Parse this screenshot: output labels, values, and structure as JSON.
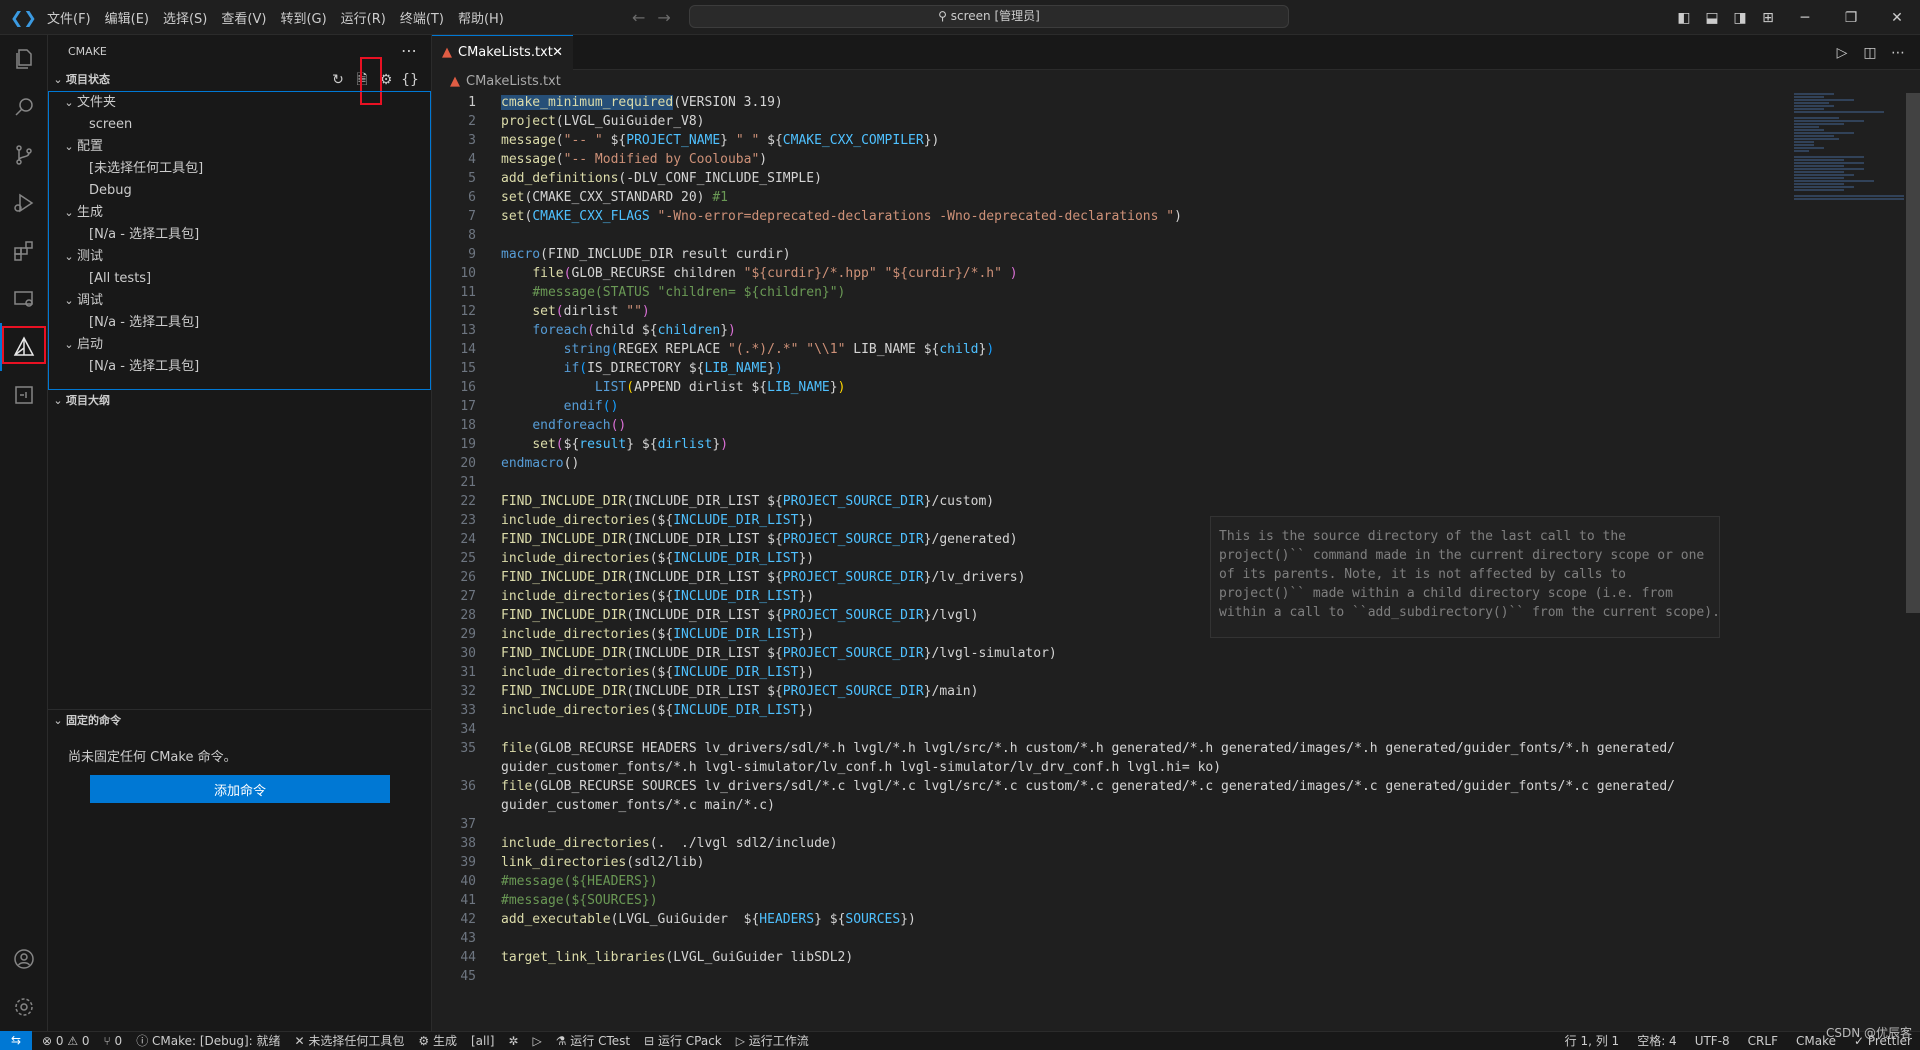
{
  "titlebar": {
    "menu": [
      "文件(F)",
      "编辑(E)",
      "选择(S)",
      "查看(V)",
      "转到(G)",
      "运行(R)",
      "终端(T)",
      "帮助(H)"
    ],
    "search": "screen [管理员]"
  },
  "sidebar": {
    "title": "CMAKE",
    "project_status": "项目状态",
    "tree": [
      {
        "label": "文件夹",
        "kind": "group"
      },
      {
        "label": "screen",
        "kind": "leaf"
      },
      {
        "label": "配置",
        "kind": "group"
      },
      {
        "label": "[未选择任何工具包]",
        "kind": "leaf"
      },
      {
        "label": "Debug",
        "kind": "leaf"
      },
      {
        "label": "生成",
        "kind": "group"
      },
      {
        "label": "[N/a - 选择工具包]",
        "kind": "leaf"
      },
      {
        "label": "测试",
        "kind": "group"
      },
      {
        "label": "[All tests]",
        "kind": "leaf"
      },
      {
        "label": "调试",
        "kind": "group"
      },
      {
        "label": "[N/a - 选择工具包]",
        "kind": "leaf"
      },
      {
        "label": "启动",
        "kind": "group"
      },
      {
        "label": "[N/a - 选择工具包]",
        "kind": "leaf"
      }
    ],
    "project_outline": "项目大纲",
    "pinned_commands": "固定的命令",
    "pinned_empty": "尚未固定任何 CMake 命令。",
    "add_command": "添加命令"
  },
  "editor": {
    "tab": "CMakeLists.txt",
    "breadcrumb": "CMakeLists.txt",
    "hover": [
      "This is the source directory of the last call to the",
      "project()`` command made in the current directory scope or one",
      "of its parents. Note, it is not affected by calls to",
      "project()`` made within a child directory scope (i.e. from",
      "within a call to ``add_subdirectory()`` from the current scope)."
    ]
  },
  "statusbar": {
    "left": [
      "⊗ 0 ⚠ 0",
      "⑂ 0",
      "ⓘ CMake: [Debug]: 就绪",
      "✕ 未选择任何工具包",
      "⚙ 生成",
      "[all]",
      "✲",
      "▷",
      "⚗ 运行 CTest",
      "⊟ 运行 CPack",
      "▷ 运行工作流"
    ],
    "right": [
      "行 1, 列 1",
      "空格: 4",
      "UTF-8",
      "CRLF",
      "CMake",
      "✓ Prettier"
    ],
    "watermark": "CSDN @优辰客"
  }
}
